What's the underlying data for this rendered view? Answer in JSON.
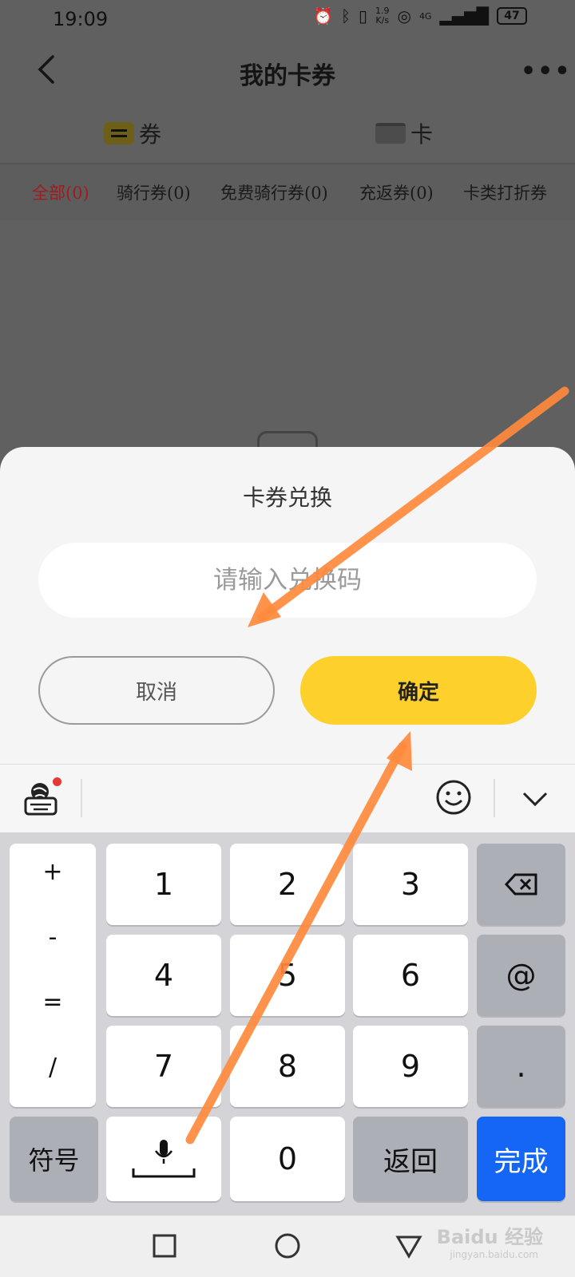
{
  "status_bar": {
    "time": "19:09",
    "speed_top": "1.9",
    "speed_bottom": "K/s",
    "network": "4G",
    "battery": "47"
  },
  "header": {
    "title": "我的卡券",
    "more": "•••"
  },
  "tabs": [
    {
      "label": "券"
    },
    {
      "label": "卡"
    }
  ],
  "filters": [
    {
      "label": "全部(0)"
    },
    {
      "label": "骑行券(0)"
    },
    {
      "label": "免费骑行券(0)"
    },
    {
      "label": "充返券(0)"
    },
    {
      "label": "卡类打折券"
    }
  ],
  "dialog": {
    "title": "卡券兑换",
    "placeholder": "请输入兑换码",
    "cancel_label": "取消",
    "confirm_label": "确定"
  },
  "keyboard": {
    "symbols": [
      "+",
      "-",
      "=",
      "/"
    ],
    "rows": [
      [
        "1",
        "2",
        "3"
      ],
      [
        "4",
        "5",
        "6"
      ],
      [
        "7",
        "8",
        "9"
      ]
    ],
    "zero": "0",
    "symbol_key": "符号",
    "back_key": "返回",
    "done_key": "完成",
    "at_key": "@",
    "dot_key": "."
  },
  "colors": {
    "accent_yellow": "#fdd02c",
    "done_blue": "#1566f5",
    "active_filter": "#a01c1c",
    "arrow": "#ff8a3d"
  },
  "watermark": {
    "brand": "Baidu 经验",
    "sub": "jingyan.baidu.com"
  }
}
